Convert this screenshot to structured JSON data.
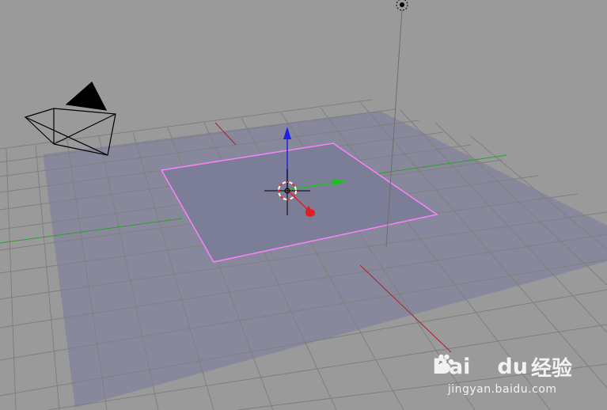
{
  "viewport": {
    "background": "#9a9a9a",
    "grid_color": "#7f7f7f",
    "x_axis_color": "#b0202a",
    "y_axis_color": "#2f9d2f",
    "ground_plane_color": "#85859c",
    "selected_plane_fill": "#7c7e98",
    "selected_outline_color": "#ff80ff"
  },
  "objects": {
    "camera": "camera",
    "lamp": "lamp",
    "plane": "plane",
    "cursor": "3d-cursor",
    "gizmo": {
      "x": "red",
      "y": "green",
      "z": "blue"
    }
  },
  "watermark": {
    "logo_left": "Bai",
    "logo_right": "du",
    "cn_text": "经验",
    "url": "jingyan.baidu.com"
  }
}
